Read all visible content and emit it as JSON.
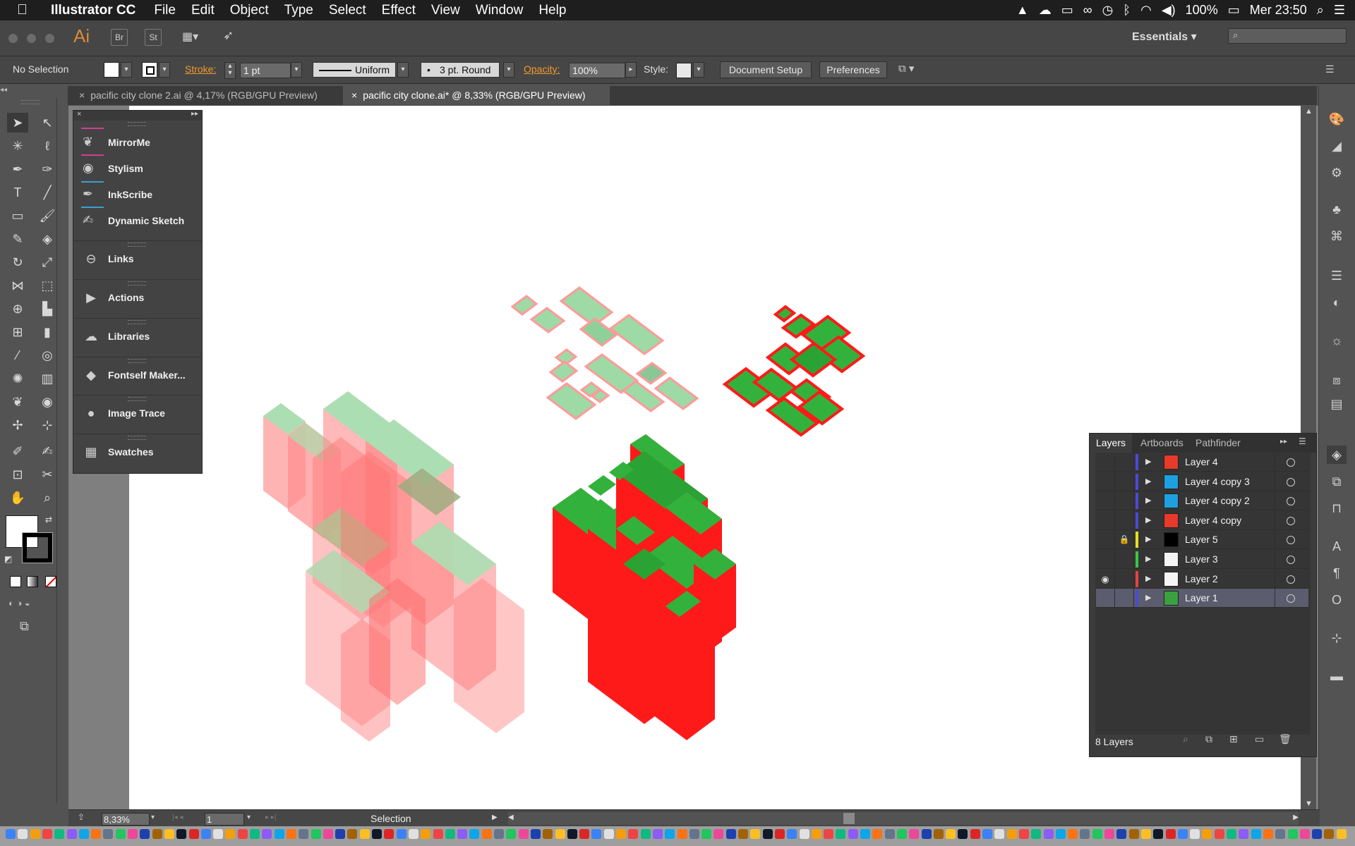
{
  "menubar": {
    "apple": "",
    "app_name": "Illustrator CC",
    "items": [
      "File",
      "Edit",
      "Object",
      "Type",
      "Select",
      "Effect",
      "View",
      "Window",
      "Help"
    ],
    "battery": "100%",
    "clock": "Mer 23:50"
  },
  "appbar": {
    "logo": "Ai",
    "br": "Br",
    "st": "St",
    "workspace": "Essentials"
  },
  "control": {
    "selection": "No Selection",
    "stroke_label": "Stroke:",
    "stroke_value": "1 pt",
    "profile": "Uniform",
    "brush": "3 pt. Round",
    "opacity_label": "Opacity:",
    "opacity_value": "100%",
    "style_label": "Style:",
    "doc_setup": "Document Setup",
    "preferences": "Preferences"
  },
  "tabs": [
    {
      "label": "pacific city clone 2.ai @ 4,17% (RGB/GPU Preview)",
      "close": "×"
    },
    {
      "label": "pacific city clone.ai* @ 8,33% (RGB/GPU Preview)",
      "close": "×"
    }
  ],
  "dock_panels": {
    "plugins": [
      "MirrorMe",
      "Stylism",
      "InkScribe",
      "Dynamic Sketch"
    ],
    "links": "Links",
    "actions": "Actions",
    "libraries": "Libraries",
    "fontself": "Fontself Maker...",
    "image_trace": "Image Trace",
    "swatches": "Swatches"
  },
  "layers_panel": {
    "tabs": [
      "Layers",
      "Artboards",
      "Pathfinder"
    ],
    "rows": [
      {
        "name": "Layer 4",
        "color": "#4a4ad8",
        "thumb": "#e83a2a",
        "visible": false,
        "locked": false
      },
      {
        "name": "Layer 4 copy 3",
        "color": "#4a4ad8",
        "thumb": "#1ea0e0",
        "visible": false,
        "locked": false
      },
      {
        "name": "Layer 4 copy 2",
        "color": "#4a4ad8",
        "thumb": "#1ea0e0",
        "visible": false,
        "locked": false
      },
      {
        "name": "Layer 4 copy",
        "color": "#4a4ad8",
        "thumb": "#e83a2a",
        "visible": false,
        "locked": false
      },
      {
        "name": "Layer 5",
        "color": "#e8e020",
        "thumb": "#000000",
        "visible": false,
        "locked": true
      },
      {
        "name": "Layer 3",
        "color": "#3ac840",
        "thumb": "#f5f5f5",
        "visible": false,
        "locked": false
      },
      {
        "name": "Layer 2",
        "color": "#e84040",
        "thumb": "#f5f5f5",
        "visible": true,
        "locked": false
      },
      {
        "name": "Layer 1",
        "color": "#4a4ad8",
        "thumb": "#3aa040",
        "visible": false,
        "locked": false,
        "selected": true
      }
    ],
    "count": "8 Layers"
  },
  "statusbar": {
    "zoom": "8,33%",
    "artboard": "1",
    "tool": "Selection"
  },
  "colors": {
    "red": "#ff1a1a",
    "green": "#33b13d",
    "pink": "#ff8c8c",
    "mint": "#9ddaa6"
  }
}
